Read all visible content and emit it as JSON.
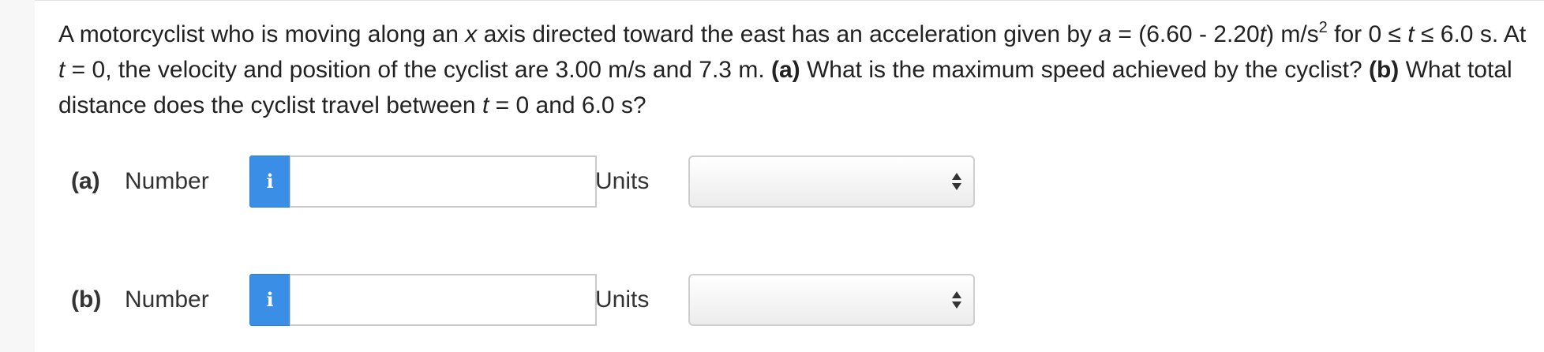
{
  "question": {
    "p1": "A motorcyclist who is moving along an ",
    "var_x": "x",
    "p2": " axis directed toward the east has an acceleration given by ",
    "var_a": "a",
    "p3": " = (6.60 - 2.20",
    "var_t1": "t",
    "p4": ") m/s",
    "sup2": "2",
    "p5": " for 0 ≤ ",
    "var_t2": "t",
    "p6": " ≤ 6.0 s. At ",
    "var_t3": "t",
    "p7": " = 0, the velocity and position of the cyclist are 3.00 m/s and 7.3 m. ",
    "part_a": "(a)",
    "p8": " What is the maximum speed achieved by the cyclist? ",
    "part_b": "(b)",
    "p9": " What total distance does the cyclist travel between ",
    "var_t4": "t",
    "p10": " = 0 and 6.0 s?"
  },
  "answers": [
    {
      "part": "(a)",
      "number_label": "Number",
      "info_glyph": "i",
      "value": "",
      "units_label": "Units",
      "units_selected": ""
    },
    {
      "part": "(b)",
      "number_label": "Number",
      "info_glyph": "i",
      "value": "",
      "units_label": "Units",
      "units_selected": ""
    }
  ],
  "colors": {
    "info_button": "#3a8ee6",
    "page_background": "#f7f7f7"
  },
  "icons": {
    "info": "info-icon",
    "select_arrows": "up-down-arrows-icon"
  }
}
